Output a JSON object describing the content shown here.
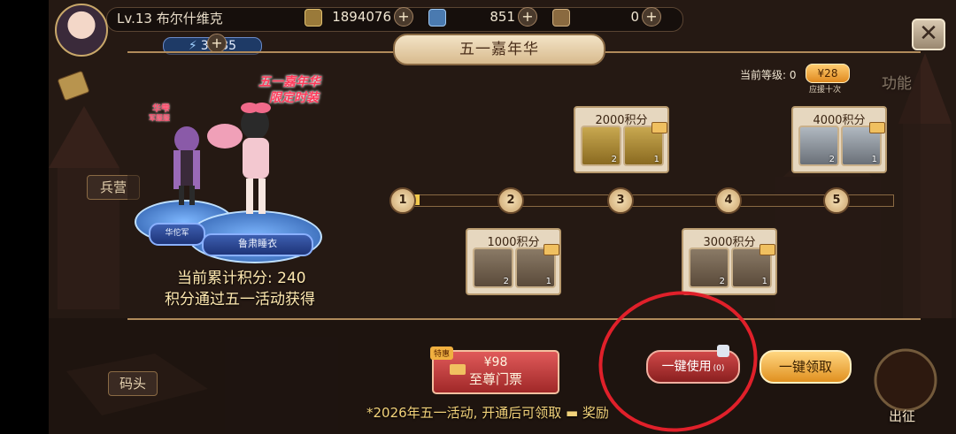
{
  "player": {
    "level_name": "Lv.13 布尔什维克",
    "gold": "1894076",
    "tickets": "851",
    "scrolls": "0",
    "energy": "31/35",
    "plus_glyph": "+"
  },
  "close_glyph": "✕",
  "event": {
    "title": "五一嘉年华",
    "current_level_label": "当前等级: 0",
    "level_badge": "¥28",
    "level_sub": "应援十次",
    "costume_small": "华雫",
    "costume_small_sub": "军服服",
    "costume_big_1": "五一嘉年华",
    "costume_big_2": "限定时装",
    "plate_left": "华佗军",
    "plate_right": "鲁肃睡衣",
    "score_line": "当前累计积分: 240",
    "score_source": "积分通过五一活动获得",
    "progress_fraction": 0.04,
    "nodes": [
      "1",
      "2",
      "3",
      "4",
      "5"
    ],
    "milestones": [
      {
        "label": "1000积分",
        "rewards": [
          {
            "icon": "feather-icon",
            "count": "2"
          },
          {
            "icon": "feather-icon",
            "count": "1"
          }
        ]
      },
      {
        "label": "2000积分",
        "rewards": [
          {
            "icon": "ticket-icon",
            "count": "2"
          },
          {
            "icon": "ticket-icon",
            "count": "1"
          }
        ]
      },
      {
        "label": "3000积分",
        "rewards": [
          {
            "icon": "letter-icon",
            "count": "2"
          },
          {
            "icon": "letter-icon",
            "count": "1"
          }
        ]
      },
      {
        "label": "4000积分",
        "rewards": [
          {
            "icon": "chest-icon",
            "count": "2"
          },
          {
            "icon": "chest-icon",
            "count": "1"
          }
        ]
      }
    ],
    "buy_tag": "特惠",
    "buy_price": "¥98",
    "buy_label": "至尊门票",
    "use_all": "一键使用",
    "use_all_count": "(0)",
    "claim_all": "一键领取",
    "hint": "*2026年五一活动, 开通后可领取 ▬ 奖励"
  },
  "side_labels": {
    "function": "功能",
    "barracks": "兵营",
    "dock": "码头",
    "depart": "出征"
  },
  "colors": {
    "accent_gold": "#f2c94c",
    "button_red": "#c23a3a",
    "button_gold": "#f0b040",
    "annotation_red": "#e0202a"
  }
}
